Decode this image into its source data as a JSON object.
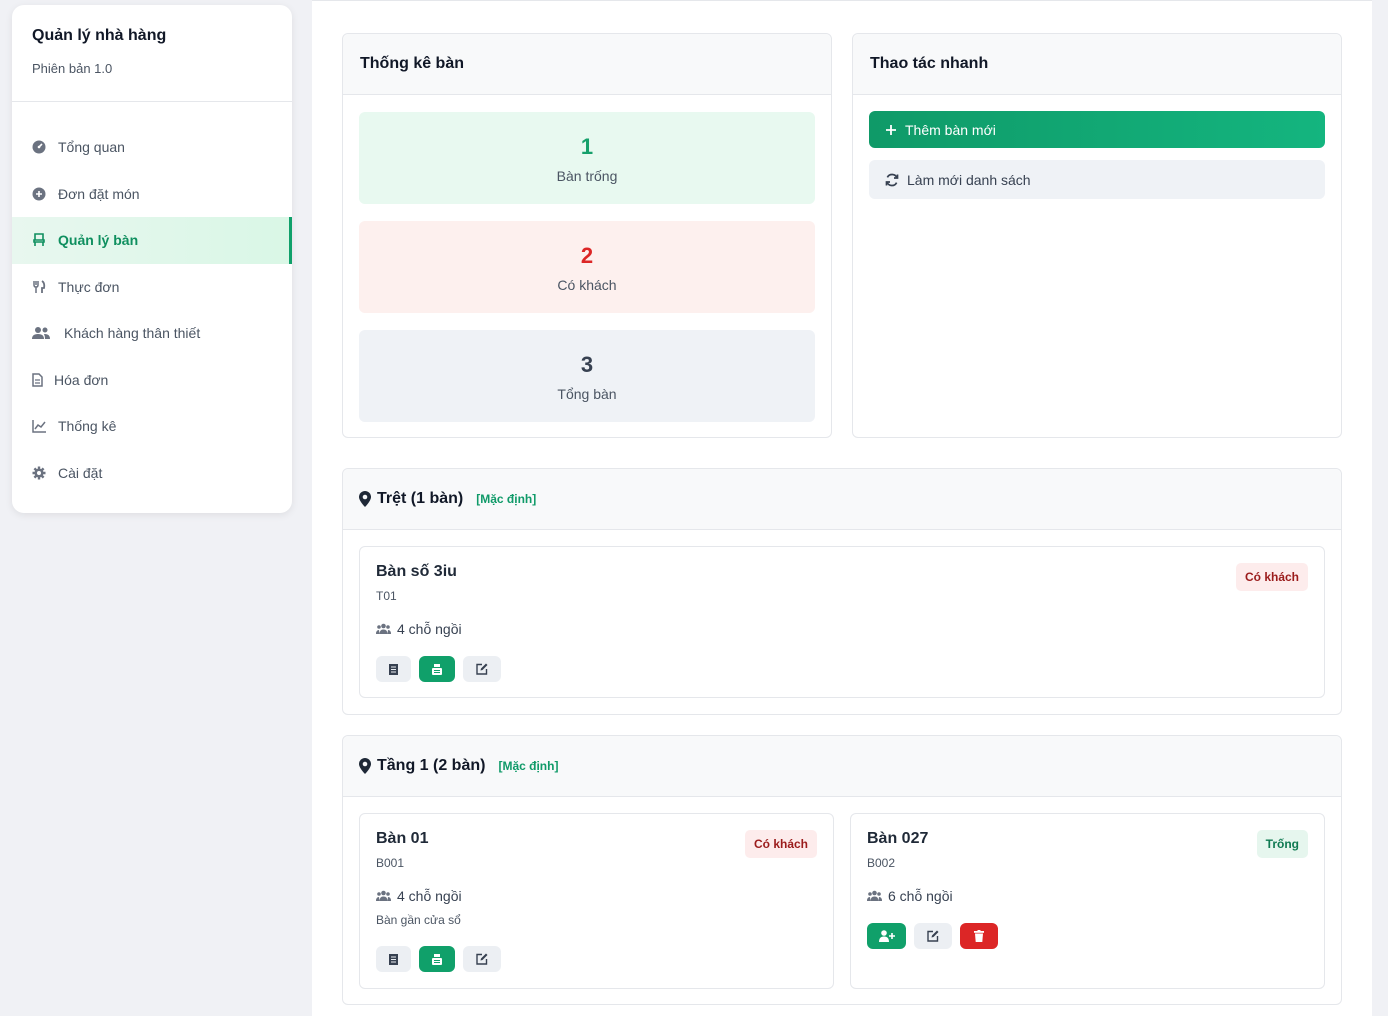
{
  "brand": {
    "title": "Quản lý nhà hàng",
    "subtitle": "Phiên bản 1.0"
  },
  "nav": [
    {
      "label": "Tổng quan",
      "icon": "dashboard-icon"
    },
    {
      "label": "Đơn đặt món",
      "icon": "plus-circle-icon"
    },
    {
      "label": "Quản lý bàn",
      "icon": "chair-icon",
      "active": true
    },
    {
      "label": "Thực đơn",
      "icon": "utensils-icon"
    },
    {
      "label": "Khách hàng thân thiết",
      "icon": "users-icon"
    },
    {
      "label": "Hóa đơn",
      "icon": "invoice-icon"
    },
    {
      "label": "Thống kê",
      "icon": "chart-line-icon"
    },
    {
      "label": "Cài đặt",
      "icon": "gear-icon"
    }
  ],
  "stats": {
    "title": "Thống kê bàn",
    "empty": {
      "value": "1",
      "label": "Bàn trống",
      "color": "#16a06b"
    },
    "occupied": {
      "value": "2",
      "label": "Có khách",
      "color": "#dc2626"
    },
    "total": {
      "value": "3",
      "label": "Tổng bàn",
      "color": "#374151"
    }
  },
  "quick": {
    "title": "Thao tác nhanh",
    "add_label": "Thêm bàn mới",
    "refresh_label": "Làm mới danh sách"
  },
  "zones": [
    {
      "name": "Trệt (1 bàn)",
      "tag": "[Mặc định]",
      "tables": [
        {
          "name": "Bàn số 3iu",
          "code": "T01",
          "seats": "4 chỗ ngồi",
          "status": "Có khách",
          "note": ""
        }
      ]
    },
    {
      "name": "Tầng 1 (2 bàn)",
      "tag": "[Mặc định]",
      "tables": [
        {
          "name": "Bàn 01",
          "code": "B001",
          "seats": "4 chỗ ngồi",
          "status": "Có khách",
          "note": "Bàn gần cửa sổ"
        },
        {
          "name": "Bàn 027",
          "code": "B002",
          "seats": "6 chỗ ngồi",
          "status": "Trống",
          "note": ""
        }
      ]
    }
  ]
}
